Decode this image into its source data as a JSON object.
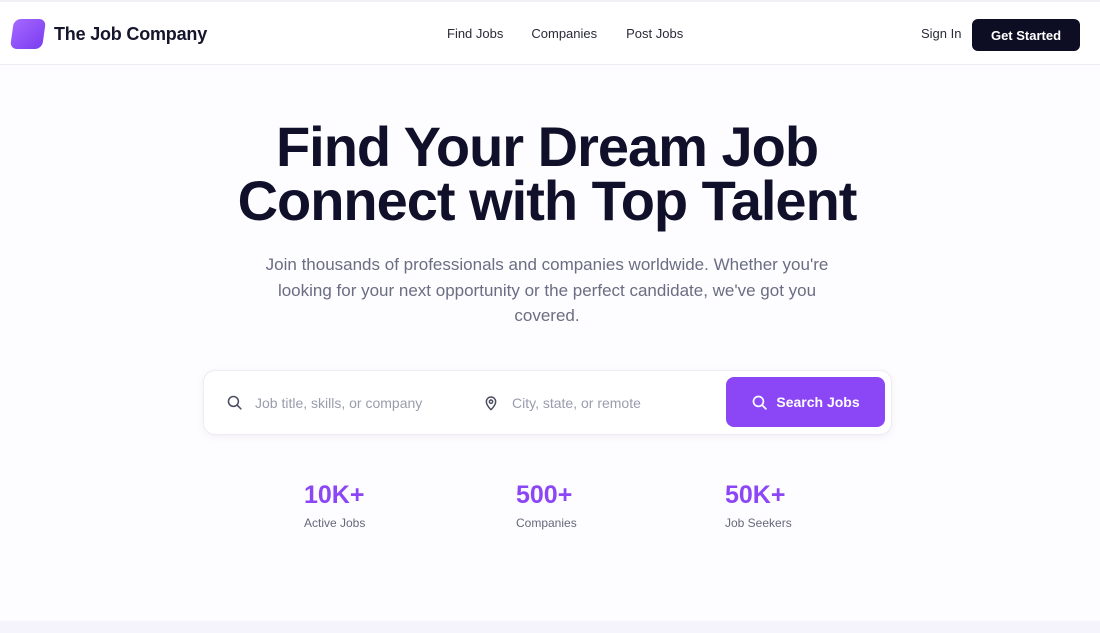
{
  "brand": {
    "name": "The Job Company",
    "logo_color": "#8b47f6"
  },
  "nav": {
    "links": [
      "Find Jobs",
      "Companies",
      "Post Jobs"
    ],
    "sign_in": "Sign In",
    "get_started": "Get Started"
  },
  "hero": {
    "title_line1": "Find Your Dream Job",
    "title_line2": "Connect with Top Talent",
    "subtitle": "Join thousands of professionals and companies worldwide. Whether you're looking for your next opportunity or the perfect candidate, we've got you covered."
  },
  "search": {
    "job_placeholder": "Job title, skills, or company",
    "job_icon": "search-icon",
    "location_placeholder": "City, state, or remote",
    "location_icon": "map-pin-icon",
    "button_label": "Search Jobs"
  },
  "stats": [
    {
      "value": "10K+",
      "label": "Active Jobs"
    },
    {
      "value": "500+",
      "label": "Companies"
    },
    {
      "value": "50K+",
      "label": "Job Seekers"
    }
  ],
  "colors": {
    "accent": "#8b47f6",
    "dark": "#0d0e24",
    "muted": "#6b6d83"
  }
}
